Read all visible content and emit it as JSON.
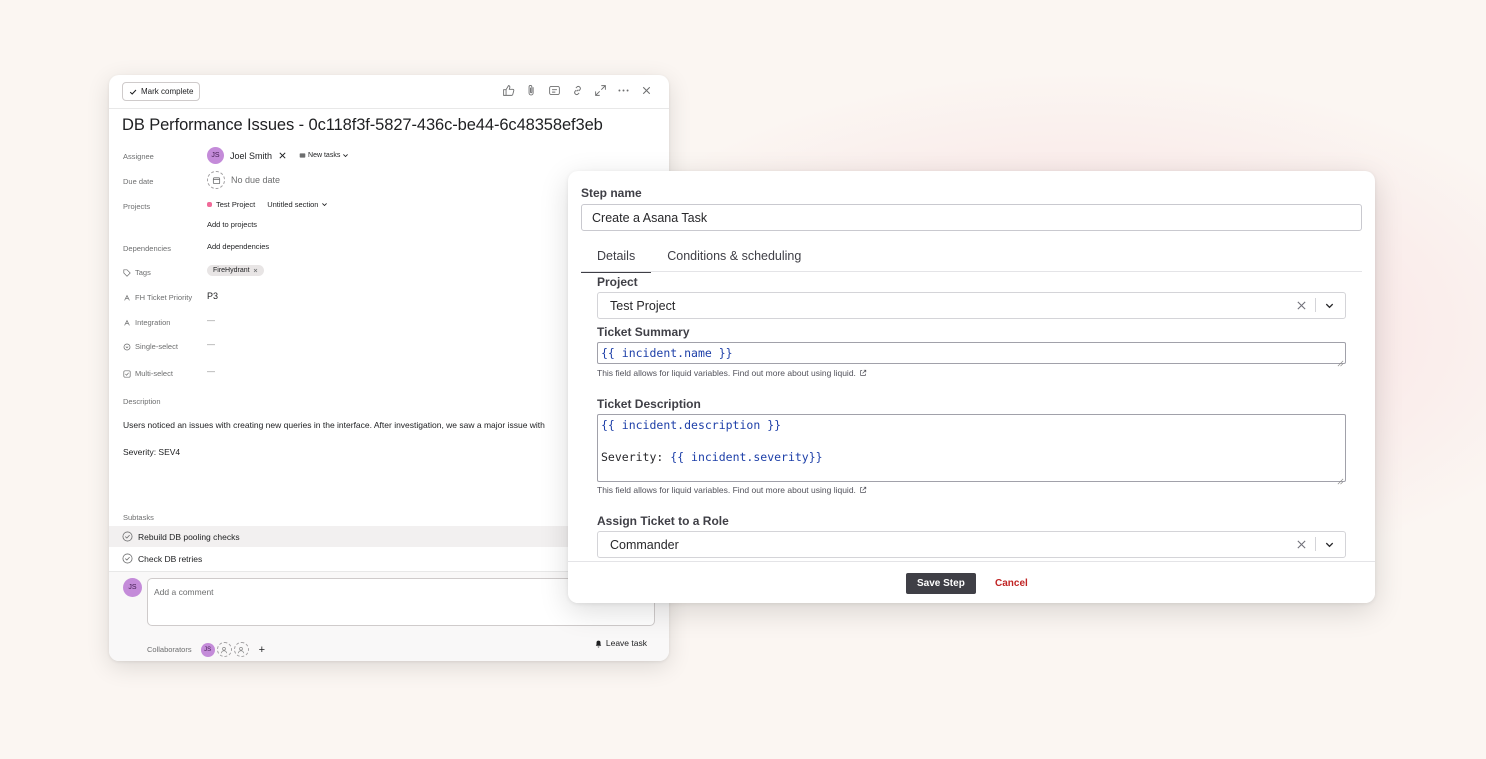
{
  "task": {
    "mark_complete_label": "Mark complete",
    "title": "DB Performance Issues  - 0c118f3f-5827-436c-be44-6c48358ef3eb",
    "fields": {
      "assignee_label": "Assignee",
      "assignee_initials": "JS",
      "assignee_name": "Joel Smith",
      "new_tasks_label": "New tasks",
      "due_date_label": "Due date",
      "due_date_value": "No due date",
      "projects_label": "Projects",
      "project_name": "Test Project",
      "section_name": "Untitled section",
      "add_to_projects": "Add to projects",
      "dependencies_label": "Dependencies",
      "add_dependencies": "Add dependencies",
      "tags_label": "Tags",
      "tag_name": "FireHydrant",
      "priority_label": "FH Ticket Priority",
      "priority_value": "P3",
      "integration_label": "Integration",
      "integration_value": "—",
      "single_select_label": "Single-select",
      "single_select_value": "—",
      "multi_select_label": "Multi-select",
      "multi_select_value": "—"
    },
    "description_label": "Description",
    "description_line1": "Users noticed an issues with creating new queries in the interface. After investigation, we saw a major issue with",
    "description_line2": "Severity: SEV4",
    "subtasks_label": "Subtasks",
    "subtasks": [
      "Rebuild DB pooling checks",
      "Check DB retries"
    ],
    "comment_avatar_initials": "JS",
    "comment_placeholder": "Add a comment",
    "collaborators_label": "Collaborators",
    "collaborator_initials": "JS",
    "add_collaborator": "+",
    "leave_task_label": "Leave task"
  },
  "modal": {
    "step_name_label": "Step name",
    "step_name_value": "Create a Asana Task",
    "tabs": [
      "Details",
      "Conditions & scheduling"
    ],
    "active_tab": "Details",
    "project_label": "Project",
    "project_value": "Test Project",
    "ticket_summary_label": "Ticket Summary",
    "ticket_summary_open": "{{",
    "ticket_summary_var": " incident.name ",
    "ticket_summary_close": "}}",
    "ticket_description_label": "Ticket Description",
    "ticket_description_open": "{{",
    "ticket_description_var": " incident.description ",
    "ticket_description_close": "}}",
    "severity_prefix": "Severity: ",
    "severity_open": "{{",
    "severity_var": " incident.severity",
    "severity_close": "}}",
    "liquid_help": "This field allows for liquid variables. Find out more about using liquid.",
    "assign_role_label": "Assign Ticket to a Role",
    "assign_role_value": "Commander",
    "save_button": "Save Step",
    "cancel_button": "Cancel"
  },
  "colors": {
    "page_background": "#fbf6f2",
    "glow": "#f7d9de",
    "avatar": "#c48bd9",
    "save_button_bg": "#3f3f46",
    "cancel_text": "#c02424",
    "liquid_variable": "#1d3fa8"
  }
}
